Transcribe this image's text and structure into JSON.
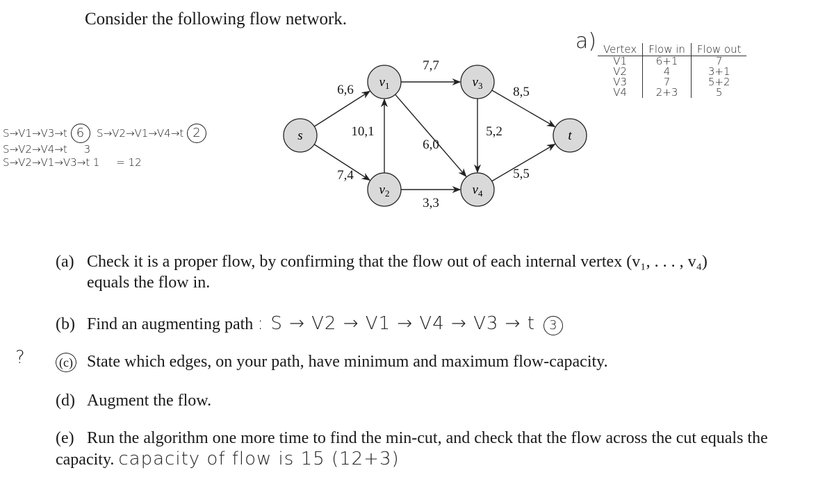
{
  "intro": "Consider the following flow network.",
  "graph": {
    "nodes": [
      {
        "id": "s",
        "label": "s"
      },
      {
        "id": "v1",
        "label": "v",
        "sub": "1"
      },
      {
        "id": "v2",
        "label": "v",
        "sub": "2"
      },
      {
        "id": "v3",
        "label": "v",
        "sub": "3"
      },
      {
        "id": "v4",
        "label": "v",
        "sub": "4"
      },
      {
        "id": "t",
        "label": "t"
      }
    ],
    "edges": [
      {
        "from": "s",
        "to": "v1",
        "label": "6,6"
      },
      {
        "from": "s",
        "to": "v2",
        "label": "7,4"
      },
      {
        "from": "v2",
        "to": "v1",
        "label": "10,1"
      },
      {
        "from": "v1",
        "to": "v3",
        "label": "7,7"
      },
      {
        "from": "v1",
        "to": "v4",
        "label": "6,0"
      },
      {
        "from": "v2",
        "to": "v4",
        "label": "3,3"
      },
      {
        "from": "v3",
        "to": "v4",
        "label": "5,2"
      },
      {
        "from": "v3",
        "to": "t",
        "label": "8,5"
      },
      {
        "from": "v4",
        "to": "t",
        "label": "5,5"
      }
    ],
    "node_fill": "#d9d9d9"
  },
  "handwritten_paths": {
    "lines": [
      {
        "path": "S→V1→V3→t",
        "value": "6"
      },
      {
        "path": "S→V2→V4→t",
        "value": "3"
      },
      {
        "path": "S→V2→V1→V3→t",
        "value": "1"
      }
    ],
    "extra_path": {
      "path": "S→V2→V1→V4→t",
      "value": "2"
    },
    "total": "= 12"
  },
  "answer_a_label": "a)",
  "flow_table": {
    "headers": [
      "Vertex",
      "Flow in",
      "Flow out"
    ],
    "rows": [
      [
        "V1",
        "6+1",
        "7"
      ],
      [
        "V2",
        "4",
        "3+1"
      ],
      [
        "V3",
        "7",
        "5+2"
      ],
      [
        "V4",
        "2+3",
        "5"
      ]
    ]
  },
  "questions": {
    "a": {
      "label": "(a)",
      "text": "Check it is a proper flow, by confirming that the flow out of each internal vertex (v₁, . . . , v₄)",
      "cont": "equals the flow in."
    },
    "b": {
      "label": "(b)",
      "text": "Find an augmenting path",
      "answer": ": S → V2 → V1 → V4 → V3 → t",
      "answer_value": "3"
    },
    "c": {
      "label": "(c)",
      "text": "State which edges, on your path, have minimum and maximum flow-capacity.",
      "margin_note": "?"
    },
    "d": {
      "label": "(d)",
      "text": "Augment the flow."
    },
    "e": {
      "label": "(e)",
      "text": "Run the algorithm one more time to find the min-cut, and check that the flow across the",
      "cont": "cut equals the capacity.",
      "answer": "capacity of flow is 15 (12+3)"
    }
  }
}
